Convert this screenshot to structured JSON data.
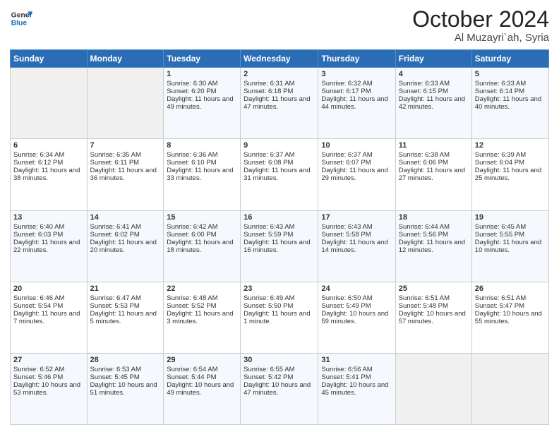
{
  "header": {
    "logo_line1": "General",
    "logo_line2": "Blue",
    "month": "October 2024",
    "location": "Al Muzayri`ah, Syria"
  },
  "columns": [
    "Sunday",
    "Monday",
    "Tuesday",
    "Wednesday",
    "Thursday",
    "Friday",
    "Saturday"
  ],
  "rows": [
    [
      {
        "empty": true
      },
      {
        "empty": true
      },
      {
        "day": 1,
        "sunrise": "6:30 AM",
        "sunset": "6:20 PM",
        "daylight": "11 hours and 49 minutes."
      },
      {
        "day": 2,
        "sunrise": "6:31 AM",
        "sunset": "6:18 PM",
        "daylight": "11 hours and 47 minutes."
      },
      {
        "day": 3,
        "sunrise": "6:32 AM",
        "sunset": "6:17 PM",
        "daylight": "11 hours and 44 minutes."
      },
      {
        "day": 4,
        "sunrise": "6:33 AM",
        "sunset": "6:15 PM",
        "daylight": "11 hours and 42 minutes."
      },
      {
        "day": 5,
        "sunrise": "6:33 AM",
        "sunset": "6:14 PM",
        "daylight": "11 hours and 40 minutes."
      }
    ],
    [
      {
        "day": 6,
        "sunrise": "6:34 AM",
        "sunset": "6:12 PM",
        "daylight": "11 hours and 38 minutes."
      },
      {
        "day": 7,
        "sunrise": "6:35 AM",
        "sunset": "6:11 PM",
        "daylight": "11 hours and 36 minutes."
      },
      {
        "day": 8,
        "sunrise": "6:36 AM",
        "sunset": "6:10 PM",
        "daylight": "11 hours and 33 minutes."
      },
      {
        "day": 9,
        "sunrise": "6:37 AM",
        "sunset": "6:08 PM",
        "daylight": "11 hours and 31 minutes."
      },
      {
        "day": 10,
        "sunrise": "6:37 AM",
        "sunset": "6:07 PM",
        "daylight": "11 hours and 29 minutes."
      },
      {
        "day": 11,
        "sunrise": "6:38 AM",
        "sunset": "6:06 PM",
        "daylight": "11 hours and 27 minutes."
      },
      {
        "day": 12,
        "sunrise": "6:39 AM",
        "sunset": "6:04 PM",
        "daylight": "11 hours and 25 minutes."
      }
    ],
    [
      {
        "day": 13,
        "sunrise": "6:40 AM",
        "sunset": "6:03 PM",
        "daylight": "11 hours and 22 minutes."
      },
      {
        "day": 14,
        "sunrise": "6:41 AM",
        "sunset": "6:02 PM",
        "daylight": "11 hours and 20 minutes."
      },
      {
        "day": 15,
        "sunrise": "6:42 AM",
        "sunset": "6:00 PM",
        "daylight": "11 hours and 18 minutes."
      },
      {
        "day": 16,
        "sunrise": "6:43 AM",
        "sunset": "5:59 PM",
        "daylight": "11 hours and 16 minutes."
      },
      {
        "day": 17,
        "sunrise": "6:43 AM",
        "sunset": "5:58 PM",
        "daylight": "11 hours and 14 minutes."
      },
      {
        "day": 18,
        "sunrise": "6:44 AM",
        "sunset": "5:56 PM",
        "daylight": "11 hours and 12 minutes."
      },
      {
        "day": 19,
        "sunrise": "6:45 AM",
        "sunset": "5:55 PM",
        "daylight": "11 hours and 10 minutes."
      }
    ],
    [
      {
        "day": 20,
        "sunrise": "6:46 AM",
        "sunset": "5:54 PM",
        "daylight": "11 hours and 7 minutes."
      },
      {
        "day": 21,
        "sunrise": "6:47 AM",
        "sunset": "5:53 PM",
        "daylight": "11 hours and 5 minutes."
      },
      {
        "day": 22,
        "sunrise": "6:48 AM",
        "sunset": "5:52 PM",
        "daylight": "11 hours and 3 minutes."
      },
      {
        "day": 23,
        "sunrise": "6:49 AM",
        "sunset": "5:50 PM",
        "daylight": "11 hours and 1 minute."
      },
      {
        "day": 24,
        "sunrise": "6:50 AM",
        "sunset": "5:49 PM",
        "daylight": "10 hours and 59 minutes."
      },
      {
        "day": 25,
        "sunrise": "6:51 AM",
        "sunset": "5:48 PM",
        "daylight": "10 hours and 57 minutes."
      },
      {
        "day": 26,
        "sunrise": "6:51 AM",
        "sunset": "5:47 PM",
        "daylight": "10 hours and 55 minutes."
      }
    ],
    [
      {
        "day": 27,
        "sunrise": "6:52 AM",
        "sunset": "5:46 PM",
        "daylight": "10 hours and 53 minutes."
      },
      {
        "day": 28,
        "sunrise": "6:53 AM",
        "sunset": "5:45 PM",
        "daylight": "10 hours and 51 minutes."
      },
      {
        "day": 29,
        "sunrise": "6:54 AM",
        "sunset": "5:44 PM",
        "daylight": "10 hours and 49 minutes."
      },
      {
        "day": 30,
        "sunrise": "6:55 AM",
        "sunset": "5:42 PM",
        "daylight": "10 hours and 47 minutes."
      },
      {
        "day": 31,
        "sunrise": "6:56 AM",
        "sunset": "5:41 PM",
        "daylight": "10 hours and 45 minutes."
      },
      {
        "empty": true
      },
      {
        "empty": true
      }
    ]
  ]
}
